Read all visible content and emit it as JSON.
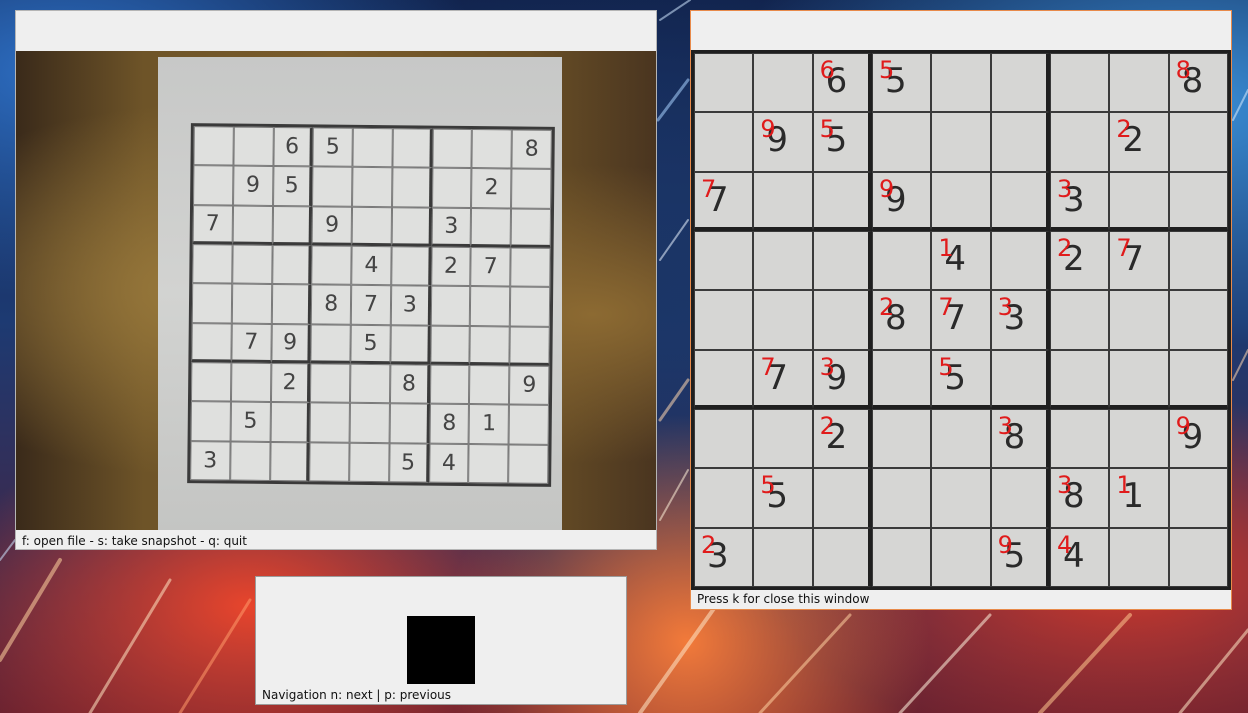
{
  "camera_window": {
    "status": "f: open file - s: take snapshot - q: quit",
    "grid": [
      [
        "",
        "",
        "6",
        "5",
        "",
        "",
        "",
        "",
        "8"
      ],
      [
        "",
        "9",
        "5",
        "",
        "",
        "",
        "",
        "2",
        ""
      ],
      [
        "7",
        "",
        "",
        "9",
        "",
        "",
        "3",
        "",
        ""
      ],
      [
        "",
        "",
        "",
        "",
        "4",
        "",
        "2",
        "7",
        ""
      ],
      [
        "",
        "",
        "",
        "8",
        "7",
        "3",
        "",
        "",
        ""
      ],
      [
        "",
        "7",
        "9",
        "",
        "5",
        "",
        "",
        "",
        ""
      ],
      [
        "",
        "",
        "2",
        "",
        "",
        "8",
        "",
        "",
        "9"
      ],
      [
        "",
        "5",
        "",
        "",
        "",
        "",
        "8",
        "1",
        ""
      ],
      [
        "3",
        "",
        "",
        "",
        "",
        "5",
        "4",
        "",
        ""
      ]
    ]
  },
  "navigation_window": {
    "status": "Navigation n: next | p: previous"
  },
  "result_window": {
    "status": "Press k for close this window",
    "cells": [
      [
        {
          "o": "",
          "s": ""
        },
        {
          "o": "",
          "s": ""
        },
        {
          "o": "6",
          "s": "6"
        },
        {
          "o": "5",
          "s": "5"
        },
        {
          "o": "",
          "s": ""
        },
        {
          "o": "",
          "s": ""
        },
        {
          "o": "",
          "s": ""
        },
        {
          "o": "",
          "s": ""
        },
        {
          "o": "8",
          "s": "8"
        }
      ],
      [
        {
          "o": "",
          "s": ""
        },
        {
          "o": "9",
          "s": "9"
        },
        {
          "o": "5",
          "s": "5"
        },
        {
          "o": "",
          "s": ""
        },
        {
          "o": "",
          "s": ""
        },
        {
          "o": "",
          "s": ""
        },
        {
          "o": "",
          "s": ""
        },
        {
          "o": "2",
          "s": "2"
        },
        {
          "o": "",
          "s": ""
        }
      ],
      [
        {
          "o": "7",
          "s": "7"
        },
        {
          "o": "",
          "s": ""
        },
        {
          "o": "",
          "s": ""
        },
        {
          "o": "9",
          "s": "9"
        },
        {
          "o": "",
          "s": ""
        },
        {
          "o": "",
          "s": ""
        },
        {
          "o": "3",
          "s": "3"
        },
        {
          "o": "",
          "s": ""
        },
        {
          "o": "",
          "s": ""
        }
      ],
      [
        {
          "o": "",
          "s": ""
        },
        {
          "o": "",
          "s": ""
        },
        {
          "o": "",
          "s": ""
        },
        {
          "o": "",
          "s": ""
        },
        {
          "o": "4",
          "s": "1"
        },
        {
          "o": "",
          "s": ""
        },
        {
          "o": "2",
          "s": "2"
        },
        {
          "o": "7",
          "s": "7"
        },
        {
          "o": "",
          "s": ""
        }
      ],
      [
        {
          "o": "",
          "s": ""
        },
        {
          "o": "",
          "s": ""
        },
        {
          "o": "",
          "s": ""
        },
        {
          "o": "8",
          "s": "2"
        },
        {
          "o": "7",
          "s": "7"
        },
        {
          "o": "3",
          "s": "3"
        },
        {
          "o": "",
          "s": ""
        },
        {
          "o": "",
          "s": ""
        },
        {
          "o": "",
          "s": ""
        }
      ],
      [
        {
          "o": "",
          "s": ""
        },
        {
          "o": "7",
          "s": "7"
        },
        {
          "o": "9",
          "s": "3"
        },
        {
          "o": "",
          "s": ""
        },
        {
          "o": "5",
          "s": "5"
        },
        {
          "o": "",
          "s": ""
        },
        {
          "o": "",
          "s": ""
        },
        {
          "o": "",
          "s": ""
        },
        {
          "o": "",
          "s": ""
        }
      ],
      [
        {
          "o": "",
          "s": ""
        },
        {
          "o": "",
          "s": ""
        },
        {
          "o": "2",
          "s": "2"
        },
        {
          "o": "",
          "s": ""
        },
        {
          "o": "",
          "s": ""
        },
        {
          "o": "8",
          "s": "3"
        },
        {
          "o": "",
          "s": ""
        },
        {
          "o": "",
          "s": ""
        },
        {
          "o": "9",
          "s": "9"
        }
      ],
      [
        {
          "o": "",
          "s": ""
        },
        {
          "o": "5",
          "s": "5"
        },
        {
          "o": "",
          "s": ""
        },
        {
          "o": "",
          "s": ""
        },
        {
          "o": "",
          "s": ""
        },
        {
          "o": "",
          "s": ""
        },
        {
          "o": "8",
          "s": "3"
        },
        {
          "o": "1",
          "s": "1"
        },
        {
          "o": "",
          "s": ""
        }
      ],
      [
        {
          "o": "3",
          "s": "2"
        },
        {
          "o": "",
          "s": ""
        },
        {
          "o": "",
          "s": ""
        },
        {
          "o": "",
          "s": ""
        },
        {
          "o": "",
          "s": ""
        },
        {
          "o": "5",
          "s": "9"
        },
        {
          "o": "4",
          "s": "4"
        },
        {
          "o": "",
          "s": ""
        },
        {
          "o": "",
          "s": ""
        }
      ]
    ]
  }
}
